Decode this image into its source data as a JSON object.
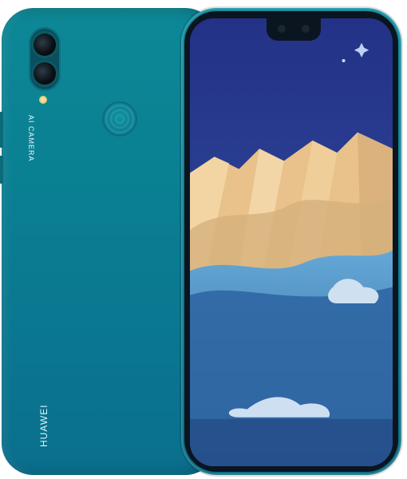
{
  "phone_back": {
    "camera_label": "AI CAMERA",
    "brand": "HUAWEI"
  },
  "colors": {
    "body": "#0b7f93",
    "screen_sky": "#2b3a8c",
    "mountain_light": "#f2d19b",
    "mountain_shadow": "#cdaa7a",
    "water_top": "#4f97c9",
    "water_bottom": "#2c5e98",
    "cloud": "#c5d9ec"
  },
  "icons": [
    "camera-lens-icon",
    "flash-icon",
    "fingerprint-icon"
  ]
}
